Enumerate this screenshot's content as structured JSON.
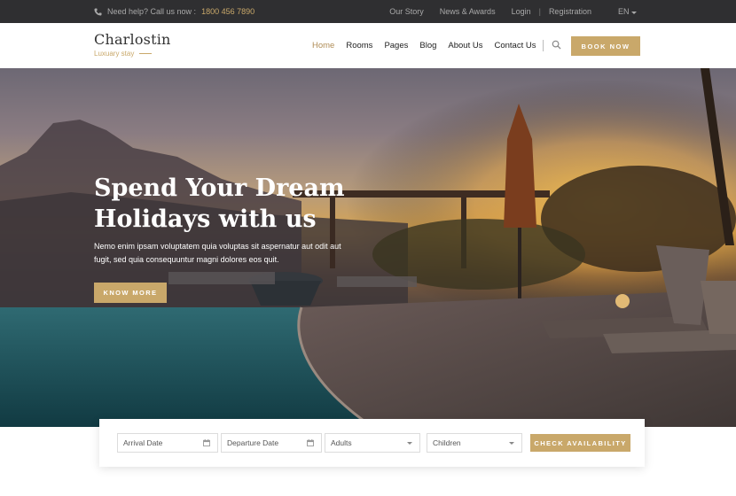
{
  "topbar": {
    "help_text": "Need help? Call us now :",
    "phone": "1800 456 7890",
    "links": [
      "Our Story",
      "News & Awards",
      "Login",
      "Registration"
    ],
    "language": "EN"
  },
  "header": {
    "logo_title": "Charlostin",
    "logo_subtitle": "Luxuary stay",
    "nav": [
      "Home",
      "Rooms",
      "Pages",
      "Blog",
      "About Us",
      "Contact Us"
    ],
    "active_nav": "Home",
    "book_button": "BOOK NOW"
  },
  "hero": {
    "title": "Spend Your Dream Holidays with us",
    "text": "Nemo enim ipsam voluptatem quia voluptas sit aspernatur aut odit aut fugit, sed quia consequuntur magni dolores eos quit.",
    "button": "KNOW MORE"
  },
  "booking": {
    "arrival_placeholder": "Arrival Date",
    "departure_placeholder": "Departure Date",
    "adults_label": "Adults",
    "children_label": "Children",
    "button": "CHECK AVAILABILITY"
  },
  "colors": {
    "accent": "#c9a86a",
    "topbar_bg": "#2f2f31"
  }
}
